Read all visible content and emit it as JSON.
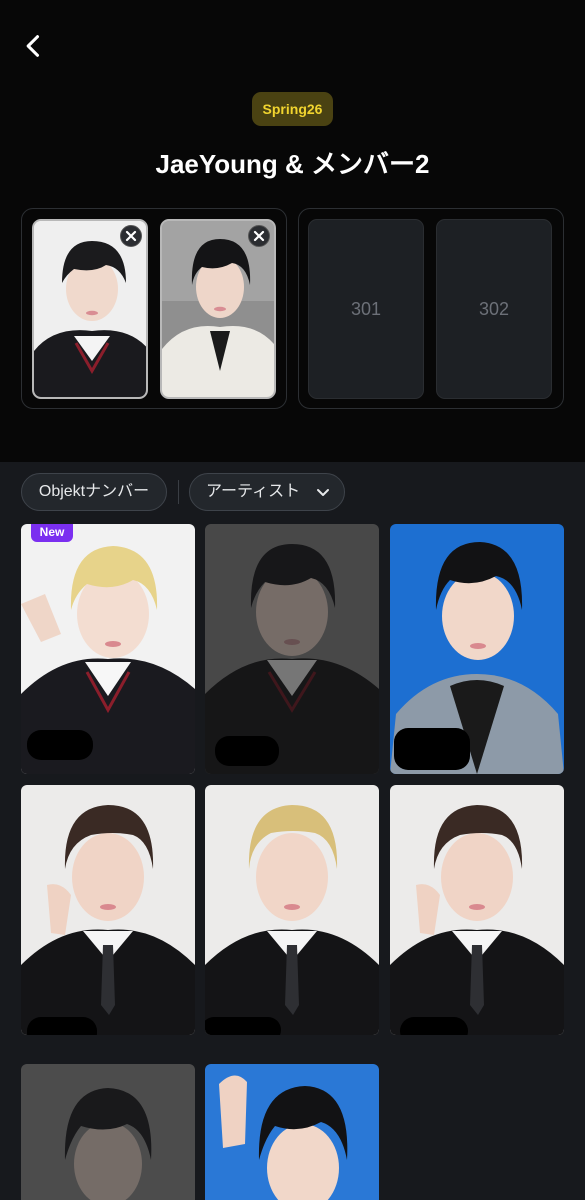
{
  "header": {
    "season_badge": "Spring26",
    "title": "JaeYoung & メンバー2"
  },
  "selected_slots": [
    {
      "filled": true
    },
    {
      "filled": true
    },
    {
      "label": "301"
    },
    {
      "label": "302"
    }
  ],
  "filters": {
    "objekt_number_label": "Objektナンバー",
    "artist_label": "アーティスト"
  },
  "grid": {
    "new_badge": "New"
  },
  "colors": {
    "background": "#17191d",
    "header_bg": "#070707",
    "badge_bg": "#4a4212",
    "badge_text": "#f1d42f",
    "new_badge": "#7b2ff0"
  }
}
